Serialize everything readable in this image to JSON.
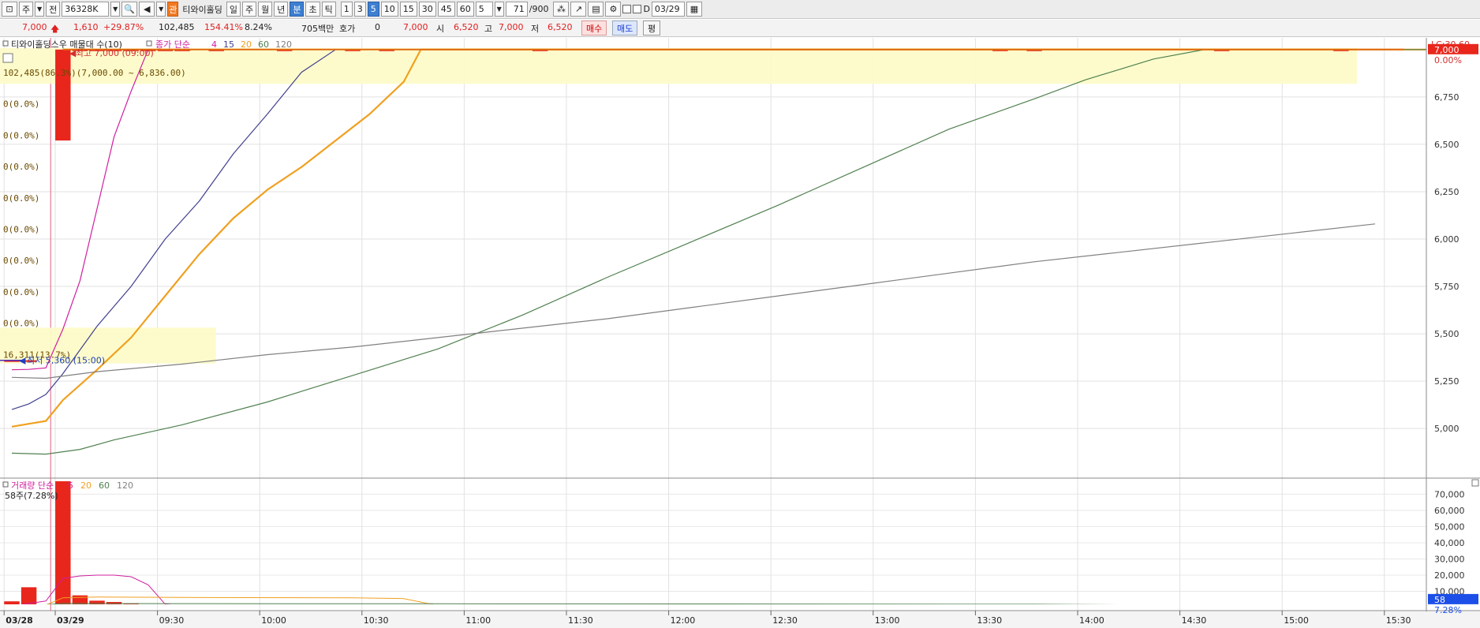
{
  "toolbar": {
    "period_type": "주",
    "market": "전",
    "code": "36328K",
    "stock_name": "티와이홀딩",
    "periods": [
      "일",
      "주",
      "월",
      "년",
      "분",
      "초",
      "틱"
    ],
    "active_period": "분",
    "intervals": [
      "1",
      "3",
      "5",
      "10",
      "15",
      "30",
      "45",
      "60"
    ],
    "active_interval": "5",
    "interval_select": "5",
    "count_value": "71",
    "count_total": "/900",
    "checkbox_label": "D",
    "date_value": "03/29"
  },
  "quote": {
    "price": "7,000",
    "change": "1,610",
    "change_rate": "+29.87%",
    "volume": "102,485",
    "volume_ratio": "154.41%",
    "turnover": "8.24%",
    "amount": "705백만",
    "hoga_label": "호가",
    "hoga_value": "0",
    "hoga_price": "7,000",
    "open_label": "시",
    "open_value": "6,520",
    "high_label": "고",
    "high_value": "7,000",
    "low_label": "저",
    "low_value": "6,520",
    "buy_label": "매수",
    "sell_label": "매도",
    "flat_label": "평"
  },
  "price_pane": {
    "legend_title": "티와이홀딩스우 매물대 수(10)",
    "ma_label": "종가 단순",
    "ma_periods": [
      "4",
      "15",
      "20",
      "60",
      "120"
    ],
    "ma_colors": [
      "#d020a0",
      "#404090",
      "#f0a020",
      "#508050",
      "#808080"
    ],
    "lc_label": "LC:30,60",
    "current_price_tag": "7,000",
    "current_rate_tag": "0.00%",
    "high_annotation": "최고 7,000 (09:00)",
    "low_annotation": "최저 5,360 (15:00)",
    "volume_profile": [
      {
        "label": "102,485(86.3%)(7,000.00 ~ 6,836.00)",
        "value": 102485,
        "from": 6836,
        "to": 7000
      },
      {
        "label": "0(0.0%)",
        "value": 0
      },
      {
        "label": "0(0.0%)",
        "value": 0
      },
      {
        "label": "0(0.0%)",
        "value": 0
      },
      {
        "label": "0(0.0%)",
        "value": 0
      },
      {
        "label": "0(0.0%)",
        "value": 0
      },
      {
        "label": "0(0.0%)",
        "value": 0
      },
      {
        "label": "0(0.0%)",
        "value": 0
      },
      {
        "label": "0(0.0%)",
        "value": 0
      },
      {
        "label": "16,311(13.7%)",
        "value": 16311,
        "from": 5360,
        "to": 5524
      }
    ]
  },
  "volume_pane": {
    "legend_title": "거래량 단순",
    "ma_periods": [
      "5",
      "20",
      "60",
      "120"
    ],
    "ma_colors": [
      "#d020a0",
      "#f0a020",
      "#508050",
      "#808080"
    ],
    "top_label": "58주(7.28%)",
    "current_volume_tag": "58",
    "current_rate_tag": "7.28%"
  },
  "chart_data": {
    "type": "candlestick",
    "price_axis": {
      "ticks": [
        5000,
        5250,
        5500,
        5750,
        6000,
        6250,
        6500,
        6750,
        7000
      ],
      "tick_labels": [
        "5,000",
        "5,250",
        "5,500",
        "5,750",
        "6,000",
        "6,250",
        "6,500",
        "6,750",
        "7,000"
      ],
      "range": [
        4780,
        7020
      ]
    },
    "volume_axis": {
      "ticks": [
        10000,
        20000,
        30000,
        40000,
        50000,
        60000,
        70000
      ],
      "tick_labels": [
        "10,000",
        "20,000",
        "30,000",
        "40,000",
        "50,000",
        "60,000",
        "70,000"
      ],
      "range": [
        0,
        78000
      ]
    },
    "x_axis": {
      "labels": [
        "03/28",
        "03/29",
        "09:30",
        "10:00",
        "10:30",
        "11:00",
        "11:30",
        "12:00",
        "12:30",
        "13:00",
        "13:30",
        "14:00",
        "14:30",
        "15:00",
        "15:30"
      ],
      "label_bar_index": [
        0,
        3,
        9,
        15,
        21,
        27,
        33,
        39,
        45,
        51,
        57,
        63,
        69,
        75,
        81
      ]
    },
    "bar_count": 86,
    "candles": [
      {
        "i": 0,
        "o": 5360,
        "h": 5360,
        "l": 5360,
        "c": 5360,
        "v": 3800
      },
      {
        "i": 1,
        "o": 5360,
        "h": 5360,
        "l": 5360,
        "c": 5360,
        "v": 12500
      },
      {
        "i": 3,
        "o": 6520,
        "h": 7000,
        "l": 6520,
        "c": 7000,
        "v": 78000
      },
      {
        "i": 4,
        "o": 7000,
        "h": 7000,
        "l": 7000,
        "c": 7000,
        "v": 7500
      },
      {
        "i": 5,
        "o": 7000,
        "h": 7000,
        "l": 7000,
        "c": 7000,
        "v": 4200
      },
      {
        "i": 6,
        "o": 7000,
        "h": 7000,
        "l": 7000,
        "c": 7000,
        "v": 3400
      },
      {
        "i": 7,
        "o": 7000,
        "h": 7000,
        "l": 7000,
        "c": 7000,
        "v": 2500
      },
      {
        "i": 8,
        "o": 7000,
        "h": 7000,
        "l": 7000,
        "c": 7000,
        "v": 1800
      },
      {
        "i": 9,
        "o": 7000,
        "h": 7000,
        "l": 7000,
        "c": 7000,
        "v": 900
      },
      {
        "i": 10,
        "o": 7000,
        "h": 7000,
        "l": 7000,
        "c": 7000,
        "v": 700
      },
      {
        "i": 12,
        "o": 7000,
        "h": 7000,
        "l": 7000,
        "c": 7000,
        "v": 500
      },
      {
        "i": 16,
        "o": 7000,
        "h": 7000,
        "l": 7000,
        "c": 7000,
        "v": 700
      },
      {
        "i": 20,
        "o": 7000,
        "h": 7000,
        "l": 7000,
        "c": 7000,
        "v": 1500
      },
      {
        "i": 22,
        "o": 7000,
        "h": 7000,
        "l": 7000,
        "c": 7000,
        "v": 500
      },
      {
        "i": 31,
        "o": 7000,
        "h": 7000,
        "l": 7000,
        "c": 7000,
        "v": 600
      },
      {
        "i": 58,
        "o": 7000,
        "h": 7000,
        "l": 7000,
        "c": 7000,
        "v": 1500
      },
      {
        "i": 60,
        "o": 7000,
        "h": 7000,
        "l": 7000,
        "c": 7000,
        "v": 800
      },
      {
        "i": 71,
        "o": 7000,
        "h": 7000,
        "l": 7000,
        "c": 7000,
        "v": 800
      },
      {
        "i": 78,
        "o": 7000,
        "h": 7000,
        "l": 7000,
        "c": 7000,
        "v": 900
      },
      {
        "i": 84,
        "o": 7000,
        "h": 7000,
        "l": 7000,
        "c": 7000,
        "v": 58
      }
    ],
    "price_ma": [
      {
        "name": "4",
        "color": "#d020a0",
        "points": [
          [
            0,
            5310
          ],
          [
            1,
            5312
          ],
          [
            2,
            5320
          ],
          [
            3,
            5525
          ],
          [
            4,
            5780
          ],
          [
            5,
            6160
          ],
          [
            6,
            6540
          ],
          [
            7,
            6780
          ],
          [
            8,
            7000
          ],
          [
            86,
            7000
          ]
        ]
      },
      {
        "name": "15",
        "color": "#404090",
        "points": [
          [
            0,
            5100
          ],
          [
            1,
            5130
          ],
          [
            2,
            5180
          ],
          [
            3,
            5290
          ],
          [
            5,
            5540
          ],
          [
            7,
            5750
          ],
          [
            9,
            6000
          ],
          [
            11,
            6200
          ],
          [
            13,
            6450
          ],
          [
            15,
            6660
          ],
          [
            17,
            6880
          ],
          [
            19,
            7000
          ],
          [
            86,
            7000
          ]
        ]
      },
      {
        "name": "20",
        "color": "#f0a020",
        "points": [
          [
            0,
            5010
          ],
          [
            1,
            5025
          ],
          [
            2,
            5040
          ],
          [
            3,
            5150
          ],
          [
            5,
            5310
          ],
          [
            7,
            5480
          ],
          [
            9,
            5700
          ],
          [
            11,
            5920
          ],
          [
            13,
            6110
          ],
          [
            15,
            6260
          ],
          [
            17,
            6380
          ],
          [
            19,
            6520
          ],
          [
            21,
            6660
          ],
          [
            23,
            6830
          ],
          [
            24,
            7000
          ],
          [
            86,
            7000
          ]
        ]
      },
      {
        "name": "60",
        "color": "#508050",
        "points": [
          [
            0,
            4870
          ],
          [
            2,
            4865
          ],
          [
            4,
            4890
          ],
          [
            6,
            4940
          ],
          [
            10,
            5020
          ],
          [
            15,
            5140
          ],
          [
            20,
            5280
          ],
          [
            25,
            5420
          ],
          [
            30,
            5600
          ],
          [
            35,
            5800
          ],
          [
            40,
            5990
          ],
          [
            45,
            6180
          ],
          [
            50,
            6380
          ],
          [
            55,
            6580
          ],
          [
            60,
            6740
          ],
          [
            63,
            6840
          ],
          [
            67,
            6950
          ],
          [
            70,
            7000
          ],
          [
            86,
            7000
          ]
        ]
      },
      {
        "name": "120",
        "color": "#808080",
        "points": [
          [
            0,
            5270
          ],
          [
            2,
            5265
          ],
          [
            5,
            5300
          ],
          [
            10,
            5340
          ],
          [
            15,
            5390
          ],
          [
            20,
            5430
          ],
          [
            25,
            5480
          ],
          [
            30,
            5530
          ],
          [
            35,
            5580
          ],
          [
            40,
            5640
          ],
          [
            45,
            5700
          ],
          [
            50,
            5760
          ],
          [
            55,
            5820
          ],
          [
            60,
            5880
          ],
          [
            65,
            5930
          ],
          [
            70,
            5980
          ],
          [
            75,
            6030
          ],
          [
            80,
            6080
          ]
        ]
      }
    ],
    "volume_ma": [
      {
        "name": "5",
        "color": "#d020a0",
        "points": [
          [
            0,
            800
          ],
          [
            1,
            2500
          ],
          [
            2,
            4000
          ],
          [
            3,
            18000
          ],
          [
            4,
            19500
          ],
          [
            5,
            20000
          ],
          [
            6,
            20000
          ],
          [
            7,
            19000
          ],
          [
            8,
            14000
          ],
          [
            9,
            2000
          ],
          [
            10,
            1200
          ],
          [
            12,
            700
          ],
          [
            20,
            800
          ],
          [
            25,
            400
          ],
          [
            40,
            300
          ],
          [
            86,
            300
          ]
        ]
      },
      {
        "name": "20",
        "color": "#f0a020",
        "points": [
          [
            0,
            600
          ],
          [
            2,
            1500
          ],
          [
            3,
            6000
          ],
          [
            5,
            6500
          ],
          [
            10,
            6200
          ],
          [
            20,
            6000
          ],
          [
            23,
            5500
          ],
          [
            25,
            1200
          ],
          [
            30,
            800
          ],
          [
            86,
            600
          ]
        ]
      },
      {
        "name": "60",
        "color": "#508050",
        "points": [
          [
            0,
            300
          ],
          [
            3,
            2500
          ],
          [
            10,
            2400
          ],
          [
            25,
            2300
          ],
          [
            40,
            2200
          ],
          [
            60,
            2000
          ],
          [
            70,
            1400
          ],
          [
            86,
            900
          ]
        ]
      },
      {
        "name": "120",
        "color": "#808080",
        "points": [
          [
            0,
            200
          ],
          [
            3,
            1200
          ],
          [
            30,
            1150
          ],
          [
            60,
            1100
          ],
          [
            86,
            1000
          ]
        ]
      }
    ]
  }
}
